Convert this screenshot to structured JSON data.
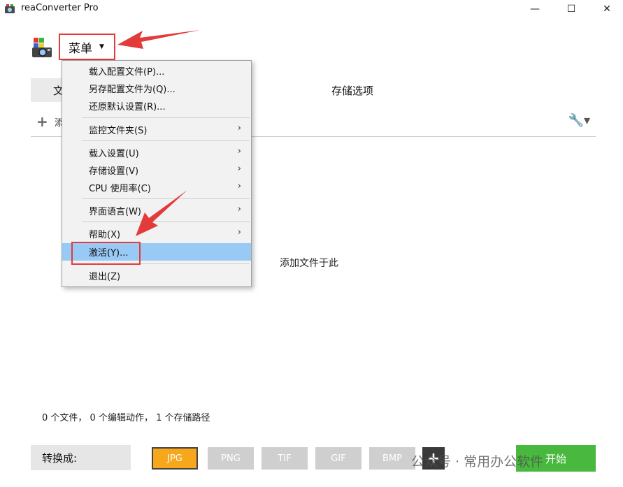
{
  "window": {
    "title": "reaConverter Pro",
    "minimize_glyph": "—",
    "maximize_glyph": "☐",
    "close_glyph": "✕"
  },
  "menu_button": {
    "label": "菜单",
    "caret": "▼"
  },
  "tabs": {
    "file": "文",
    "storage": "存储选项"
  },
  "toolbar": {
    "add_icon": "+",
    "add_label": "添",
    "tools_icon": "🔧▾"
  },
  "main": {
    "drop_hint": "添加文件于此",
    "status": "0 个文件， 0 个编辑动作， 1 个存储路径"
  },
  "menu_items": [
    {
      "label": "载入配置文件(P)...",
      "submenu": ""
    },
    {
      "label": "另存配置文件为(Q)...",
      "submenu": ""
    },
    {
      "label": "还原默认设置(R)...",
      "submenu": ""
    },
    {
      "label": "监控文件夹(S)",
      "submenu": "›"
    },
    {
      "label": "载入设置(U)",
      "submenu": "›"
    },
    {
      "label": "存储设置(V)",
      "submenu": "›"
    },
    {
      "label": "CPU 使用率(C)",
      "submenu": "›"
    },
    {
      "label": "界面语言(W)",
      "submenu": "›"
    },
    {
      "label": "帮助(X)",
      "submenu": "›"
    },
    {
      "label": "激活(Y)...",
      "submenu": ""
    },
    {
      "label": "退出(Z)",
      "submenu": ""
    }
  ],
  "bottom": {
    "convert_label": "转换成:",
    "formats": [
      "JPG",
      "PNG",
      "TIF",
      "GIF",
      "BMP"
    ],
    "active_format": "JPG",
    "add_format": "+",
    "start": "开始"
  },
  "watermark": "公众号 · 常用办公软件",
  "colors": {
    "annotation_red": "#e33a3a",
    "active_format": "#f6a71b",
    "start_green": "#48b83f",
    "menu_highlight": "#99c9f5"
  }
}
